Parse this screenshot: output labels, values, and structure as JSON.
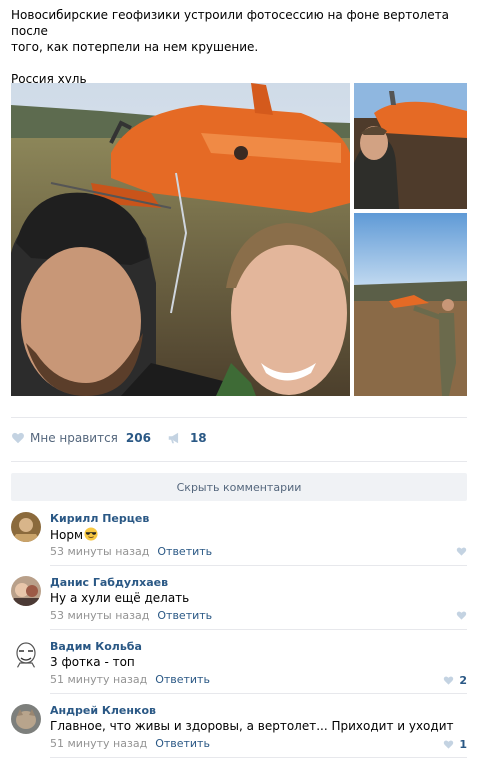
{
  "post": {
    "text_line1": "Новосибирские геофизики устроили фотосессию на фоне вертолета после",
    "text_line2": "того, как потерпели на нем крушение.",
    "text_line3": "Россия хуль"
  },
  "actions": {
    "like_label": "Мне нравится",
    "like_count": "206",
    "share_count": "18"
  },
  "comments_toggle": "Скрыть комментарии",
  "comments": [
    {
      "author": "Кирилл Перцев",
      "text": "Норм",
      "emoji": "sunglasses-emoji",
      "time": "53 минуты назад",
      "reply": "Ответить",
      "likes": ""
    },
    {
      "author": "Данис Габдулхаев",
      "text": "Ну а хули ещё делать",
      "time": "53 минуты назад",
      "reply": "Ответить",
      "likes": ""
    },
    {
      "author": "Вадим Кольба",
      "text": "3 фотка - топ",
      "time": "51 минуту назад",
      "reply": "Ответить",
      "likes": "2"
    },
    {
      "author": "Андрей Кленков",
      "text": "Главное, что живы и здоровы, а вертолет... Приходит и уходит",
      "time": "51 минуту назад",
      "reply": "Ответить",
      "likes": "1"
    }
  ],
  "colors": {
    "link": "#2a5885",
    "muted": "#939393",
    "heart": "#c4d3e2",
    "divider": "#e7e8ec",
    "helicopter": "#e56a25"
  },
  "icons": [
    "heart-icon",
    "megaphone-icon"
  ]
}
